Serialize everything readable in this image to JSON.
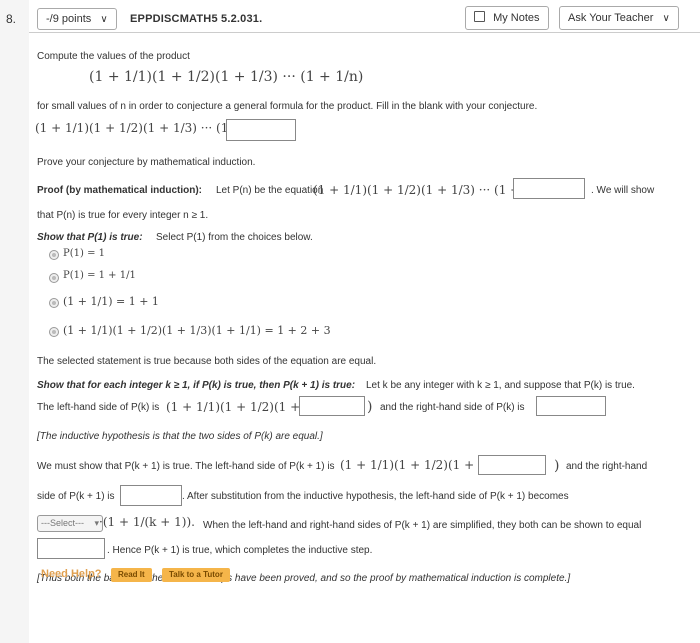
{
  "question": {
    "number": "8.",
    "points_label": "-/9 points",
    "code": "EPPDISCMATH5 5.2.031."
  },
  "toolbar": {
    "my_notes": "My Notes",
    "ask_teacher": "Ask Your Teacher"
  },
  "body": {
    "compute_text": "Compute the values of the product",
    "product_expr": "(1 + 1/1)(1 + 1/2)(1 + 1/3) ··· (1 + 1/n)",
    "small_values_text": "for small values of n in order to conjecture a general formula for the product. Fill in the blank with your conjecture.",
    "conjecture_expr": "(1 + 1/1)(1 + 1/2)(1 + 1/3) ··· (1 + 1/n) =",
    "prove_text": "Prove your conjecture by mathematical induction.",
    "proof_label": "Proof (by mathematical induction):",
    "proof_text": "Let P(n) be the equation",
    "proof_expr": "(1 + 1/1)(1 + 1/2)(1 + 1/3) ··· (1 + 1/n) =",
    "we_will_show": ". We will show",
    "that_text": "that P(n) is true for every integer n ≥ 1.",
    "show_label": "Show that P(1) is true:",
    "show_text": "Select P(1) from the choices below.",
    "choices": [
      "P(1) = 1",
      "P(1) = 1 + 1/1",
      "(1 + 1/1) = 1 + 1",
      "(1 + 1/1)(1 + 1/2)(1 + 1/3)(1 + 1/1) = 1 + 2 + 3"
    ],
    "selected_statement": "The selected statement is true because both sides of the equation are equal.",
    "inductive_label": "Show that for each integer k ≥ 1, if P(k) is true, then P(k + 1) is true:",
    "inductive_text": "Let k be any integer with k ≥ 1, and suppose that P(k) is true.",
    "lhs_text": "The left-hand side of P(k) is",
    "lhs_expr": "(1 + 1/1)(1 + 1/2)(1 + 1/3)···(",
    "rhs_text": "and the right-hand side of P(k) is",
    "hyp_text": "[The inductive hypothesis is that the two sides of P(k) are equal.]",
    "must_show": "We must show that P(k + 1) is true. The left-hand side of P(k + 1) is",
    "must_expr": "(1 + 1/1)(1 + 1/2)(1 + 1/3)···(",
    "and_rhs": "and the right-hand",
    "side_of": "side of P(k + 1) is",
    "after_sub": ". After substitution from the inductive hypothesis, the left-hand side of P(k + 1) becomes",
    "select_placeholder": "---Select---",
    "after_select_expr": "·(1 + 1/(k + 1)).",
    "when_text": "When the left-hand and right-hand sides of P(k + 1) are simplified, they both can be shown to equal",
    "hence_text": ". Hence P(k + 1) is true, which completes the inductive step.",
    "conclusion": "[Thus both the basis and the inductive steps have been proved, and so the proof by mathematical induction is complete.]"
  },
  "help": {
    "need_help": "Need Help?",
    "read_it": "Read It",
    "talk_to_tutor": "Talk to a Tutor"
  }
}
